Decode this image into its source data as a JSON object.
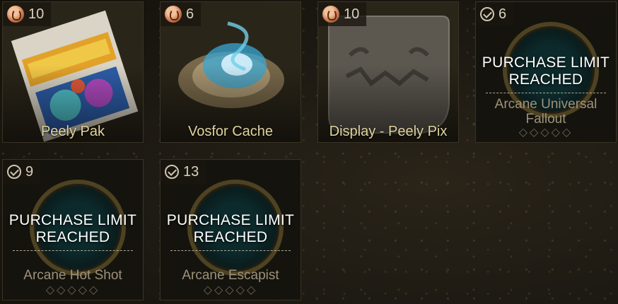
{
  "cards": [
    {
      "id": "peely-pak",
      "cost": "10",
      "cost_icon": "coin-icon",
      "name": "Peely Pak",
      "limit": null
    },
    {
      "id": "vosfor-cache",
      "cost": "6",
      "cost_icon": "coin-icon",
      "name": "Vosfor Cache",
      "limit": null
    },
    {
      "id": "display-peely-pix",
      "cost": "10",
      "cost_icon": "coin-icon",
      "name": "Display - Peely Pix",
      "limit": null
    },
    {
      "id": "arcane-universal-fallout",
      "cost": "6",
      "cost_icon": "check-icon",
      "name": "Arcane Universal Fallout",
      "limit_line1": "PURCHASE LIMIT",
      "limit_line2": "REACHED",
      "rank": "◇◇◇◇◇"
    },
    {
      "id": "arcane-hot-shot",
      "cost": "9",
      "cost_icon": "check-icon",
      "name": "Arcane Hot Shot",
      "limit_line1": "PURCHASE LIMIT",
      "limit_line2": "REACHED",
      "rank": "◇◇◇◇◇"
    },
    {
      "id": "arcane-escapist",
      "cost": "13",
      "cost_icon": "check-icon",
      "name": "Arcane Escapist",
      "limit_line1": "PURCHASE LIMIT",
      "limit_line2": "REACHED",
      "rank": "◇◇◇◇◇"
    }
  ],
  "colors": {
    "name_gold": "#e1d49e",
    "dim_name": "#9d927a",
    "panel": "#231f17",
    "border": "#3a3326"
  }
}
